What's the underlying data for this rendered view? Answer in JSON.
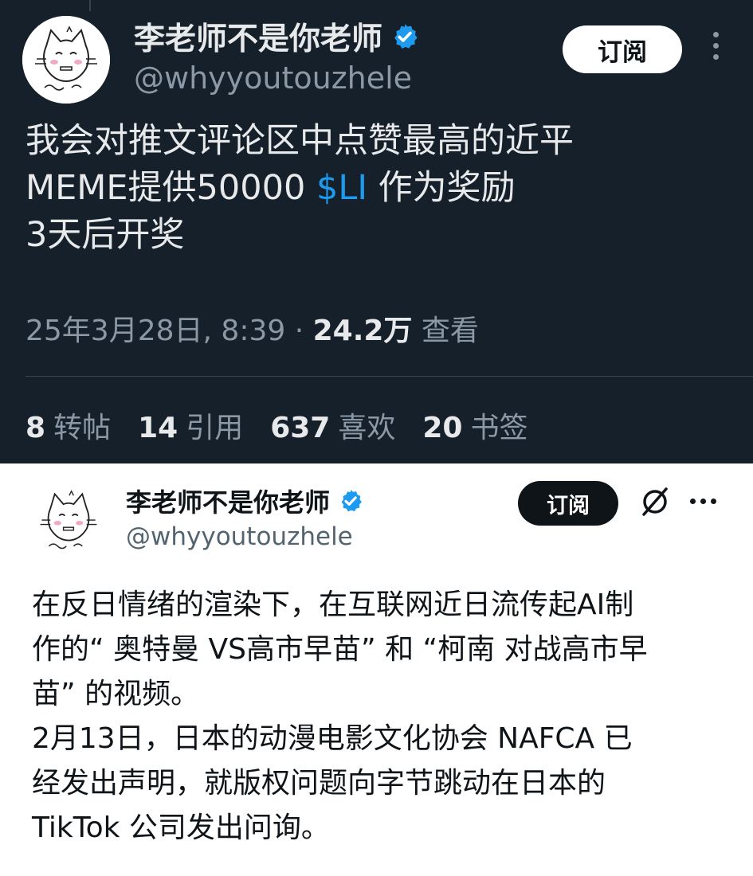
{
  "dark_tweet": {
    "author": {
      "display_name": "李老师不是你老师",
      "handle": "@whyyoutouzhele",
      "verified_icon": "verified-badge-icon"
    },
    "subscribe_label": "订阅",
    "body_lines": [
      "我会对推文评论区中点赞最高的近平",
      "MEME提供50000",
      "$LI",
      "作为奖励",
      "3天后开奖"
    ],
    "timestamp": "25年3月28日, 8:39 ·",
    "views_count": "24.2万",
    "views_label": "查看",
    "stats": {
      "reposts_count": "8",
      "reposts_label": "转帖",
      "quotes_count": "14",
      "quotes_label": "引用",
      "likes_count": "637",
      "likes_label": "喜欢",
      "bookmarks_count": "20",
      "bookmarks_label": "书签"
    }
  },
  "light_tweet": {
    "author": {
      "display_name": "李老师不是你老师",
      "handle": "@whyyoutouzhele"
    },
    "subscribe_label": "订阅",
    "body_lines": [
      "在反日情绪的渲染下，在互联网近日流传起AI制",
      "作的“ 奥特曼 VS高市早苗” 和 “柯南 对战高市早",
      "苗” 的视频。",
      "2月13日，日本的动漫电影文化协会 NAFCA 已",
      "经发出声明，就版权问题向字节跳动在日本的",
      "TikTok 公司发出问询。"
    ]
  },
  "colors": {
    "dark_bg": "#15202b",
    "dark_text": "#e7e9ea",
    "dark_muted": "#8b98a5",
    "accent_blue": "#1d9bf0",
    "light_text": "#0f1419",
    "light_muted": "#536471"
  }
}
